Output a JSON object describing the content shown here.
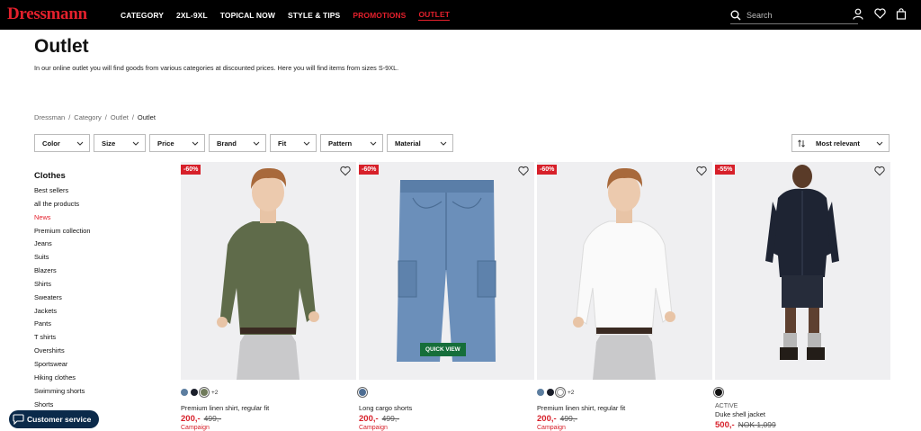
{
  "header": {
    "logo": "Dressmann",
    "nav": [
      {
        "label": "CATEGORY",
        "style": "white"
      },
      {
        "label": "2XL-9XL",
        "style": "white"
      },
      {
        "label": "TOPICAL NOW",
        "style": "white"
      },
      {
        "label": "STYLE & TIPS",
        "style": "white"
      },
      {
        "label": "PROMOTIONS",
        "style": "red"
      },
      {
        "label": "OUTLET",
        "style": "active"
      }
    ],
    "search_placeholder": "Search",
    "icons": [
      "user-icon",
      "heart-icon",
      "bag-icon"
    ]
  },
  "page": {
    "title": "Outlet",
    "intro": "In our online outlet you will find goods from various categories at discounted prices. Here you will find items from sizes S-9XL.",
    "breadcrumb": [
      "Dressman",
      "Category",
      "Outlet",
      "Outlet"
    ]
  },
  "filters": [
    "Color",
    "Size",
    "Price",
    "Brand",
    "Fit",
    "Pattern",
    "Material"
  ],
  "sort_label": "Most relevant",
  "sidebar": {
    "heading": "Clothes",
    "items": [
      "Best sellers",
      "all the products",
      "News",
      "Premium collection",
      "Jeans",
      "Suits",
      "Blazers",
      "Shirts",
      "Sweaters",
      "Jackets",
      "Pants",
      "T shirts",
      "Overshirts",
      "Sportswear",
      "Hiking clothes",
      "Swimming shorts",
      "Shorts"
    ],
    "highlight_index": 2
  },
  "products": [
    {
      "badge": "-60%",
      "name": "Premium linen shirt, regular fit",
      "price": "200,-",
      "old_price": "499,-",
      "campaign": "Campaign",
      "brand": "",
      "swatches": [
        "#5c7ea0",
        "#1a1e2a",
        "#6f7a5a"
      ],
      "more": "+2",
      "selected_swatch": 2,
      "image": "green-shirt"
    },
    {
      "badge": "-60%",
      "name": "Long cargo shorts",
      "price": "200,-",
      "old_price": "499,-",
      "campaign": "Campaign",
      "brand": "",
      "swatches": [
        "#4d6d92"
      ],
      "more": "",
      "selected_swatch": 0,
      "image": "cargo-shorts",
      "quick_view": "QUICK VIEW"
    },
    {
      "badge": "-60%",
      "name": "Premium linen shirt, regular fit",
      "price": "200,-",
      "old_price": "499,-",
      "campaign": "Campaign",
      "brand": "",
      "swatches": [
        "#5c7ea0",
        "#1a1e2a",
        "#ffffff"
      ],
      "more": "+2",
      "selected_swatch": 2,
      "image": "white-shirt"
    },
    {
      "badge": "-55%",
      "name": "Duke shell jacket",
      "price": "500,-",
      "old_price": "NOK 1,099",
      "campaign": "",
      "brand": "ACTIVE",
      "swatches": [
        "#111111"
      ],
      "more": "",
      "selected_swatch": 0,
      "image": "shell-jacket"
    }
  ],
  "customer_service": "Customer service"
}
